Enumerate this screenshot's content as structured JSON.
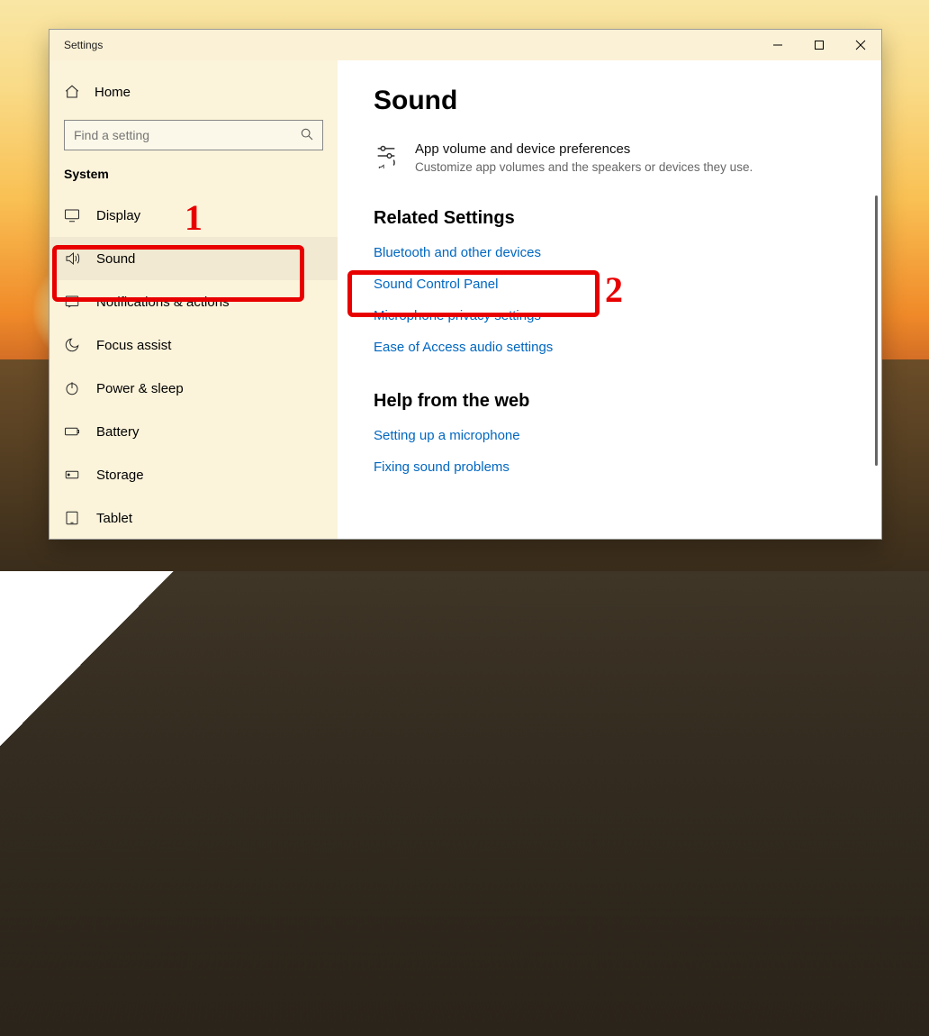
{
  "window_title": "Settings",
  "sidebar": {
    "home": "Home",
    "search_placeholder": "Find a setting",
    "section": "System",
    "items": [
      {
        "label": "Display",
        "icon": "display-icon"
      },
      {
        "label": "Sound",
        "icon": "sound-icon",
        "active": true
      },
      {
        "label": "Notifications & actions",
        "icon": "notifications-icon"
      },
      {
        "label": "Focus assist",
        "icon": "moon-icon"
      },
      {
        "label": "Power & sleep",
        "icon": "power-icon"
      },
      {
        "label": "Battery",
        "icon": "battery-icon"
      },
      {
        "label": "Storage",
        "icon": "storage-icon"
      },
      {
        "label": "Tablet",
        "icon": "tablet-icon"
      }
    ]
  },
  "content": {
    "page_title": "Sound",
    "pref": {
      "title": "App volume and device preferences",
      "desc": "Customize app volumes and the speakers or devices they use."
    },
    "related_heading": "Related Settings",
    "related_links": [
      "Bluetooth and other devices",
      "Sound Control Panel",
      "Microphone privacy settings",
      "Ease of Access audio settings"
    ],
    "help_heading": "Help from the web",
    "help_links": [
      "Setting up a microphone",
      "Fixing sound problems"
    ]
  },
  "annotations": {
    "label1": "1",
    "label2": "2"
  }
}
